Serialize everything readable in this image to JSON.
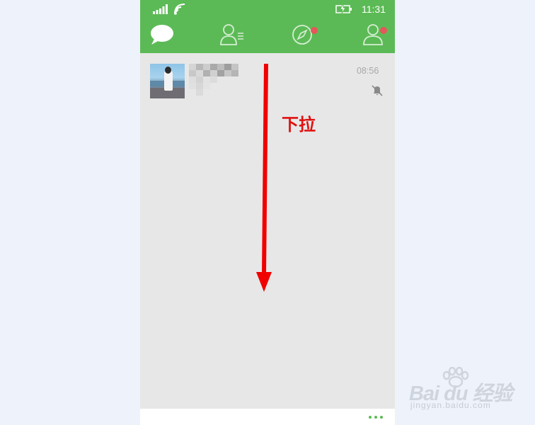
{
  "status_bar": {
    "time": "11:31",
    "icons": [
      "signal-icon",
      "wifi-icon",
      "battery-charging-icon"
    ]
  },
  "nav_tabs": [
    {
      "name": "chats",
      "icon": "chat-bubble-icon",
      "active": true,
      "badge": false
    },
    {
      "name": "contacts",
      "icon": "contacts-icon",
      "active": false,
      "badge": false
    },
    {
      "name": "discover",
      "icon": "compass-icon",
      "active": false,
      "badge": true
    },
    {
      "name": "me",
      "icon": "person-icon",
      "active": false,
      "badge": true
    }
  ],
  "chat_list": [
    {
      "time": "08:56",
      "muted": true,
      "icon": "mute-bell-icon"
    }
  ],
  "bottom_bar": {
    "icon": "more-dots-icon"
  },
  "annotation": {
    "text": "下拉"
  },
  "watermark": {
    "brand": "Bai du 经验",
    "url": "jingyan.baidu.com"
  },
  "colors": {
    "header_green": "#5cba56",
    "badge_red": "#e4585b",
    "annotation_red": "#e01010",
    "list_bg": "#e7e7e7"
  }
}
